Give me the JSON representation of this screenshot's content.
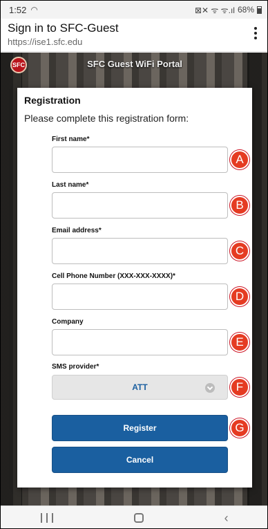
{
  "status_bar": {
    "time": "1:52",
    "left_icon": "wifi-icon",
    "icons": "⊠✕ ᯤ ᯤ.ıl",
    "battery": "68%"
  },
  "app_bar": {
    "title": "Sign in to SFC-Guest",
    "url": "https://ise1.sfc.edu"
  },
  "portal": {
    "logo_text": "SFC",
    "title": "SFC Guest WiFi Portal"
  },
  "form": {
    "heading": "Registration",
    "subheading": "Please complete this registration form:",
    "fields": [
      {
        "label": "First name*",
        "value": "",
        "badge": "A"
      },
      {
        "label": "Last name*",
        "value": "",
        "badge": "B"
      },
      {
        "label": "Email address*",
        "value": "",
        "badge": "C"
      },
      {
        "label": "Cell Phone Number (XXX-XXX-XXXX)*",
        "value": "",
        "badge": "D"
      },
      {
        "label": "Company",
        "value": "",
        "badge": "E"
      }
    ],
    "sms": {
      "label": "SMS provider*",
      "selected": "ATT",
      "badge": "F"
    },
    "register": {
      "label": "Register",
      "badge": "G"
    },
    "cancel": {
      "label": "Cancel"
    }
  },
  "colors": {
    "accent": "#1a5fa0",
    "badge": "#e53b22"
  }
}
